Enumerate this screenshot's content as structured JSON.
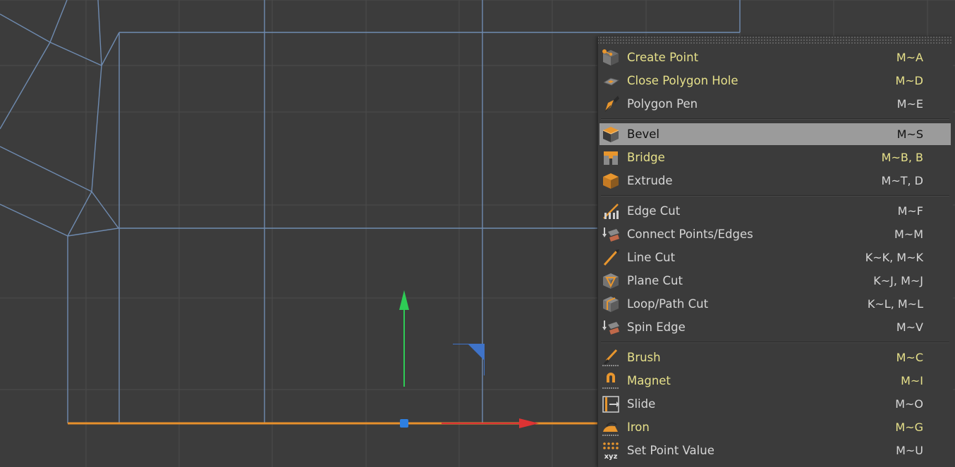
{
  "colors": {
    "viewport_bg": "#3c3c3c",
    "grid_line": "#4a4a4a",
    "wire_line": "#6f8bb0",
    "selected_edge": "#e8902c",
    "axis_y": "#2ecc55",
    "axis_x": "#dd3333",
    "menu_bg": "#3b3b3b",
    "menu_highlight_text": "#e6e08a",
    "menu_text": "#d6d6d6",
    "menu_active_bg": "#9b9b9b"
  },
  "menu": {
    "groups": [
      [
        {
          "label": "Create Point",
          "shortcut": "M~A",
          "icon": "create-point-icon",
          "highlight": true,
          "active": false
        },
        {
          "label": "Close Polygon Hole",
          "shortcut": "M~D",
          "icon": "close-polygon-hole-icon",
          "highlight": true,
          "active": false
        },
        {
          "label": "Polygon Pen",
          "shortcut": "M~E",
          "icon": "polygon-pen-icon",
          "highlight": false,
          "active": false
        }
      ],
      [
        {
          "label": "Bevel",
          "shortcut": "M~S",
          "icon": "bevel-icon",
          "highlight": false,
          "active": true
        },
        {
          "label": "Bridge",
          "shortcut": "M~B, B",
          "icon": "bridge-icon",
          "highlight": true,
          "active": false
        },
        {
          "label": "Extrude",
          "shortcut": "M~T, D",
          "icon": "extrude-icon",
          "highlight": false,
          "active": false
        }
      ],
      [
        {
          "label": "Edge Cut",
          "shortcut": "M~F",
          "icon": "edge-cut-icon",
          "highlight": false,
          "active": false
        },
        {
          "label": "Connect Points/Edges",
          "shortcut": "M~M",
          "icon": "connect-points-edges-icon",
          "highlight": false,
          "active": false
        },
        {
          "label": "Line Cut",
          "shortcut": "K~K, M~K",
          "icon": "line-cut-icon",
          "highlight": false,
          "active": false
        },
        {
          "label": "Plane Cut",
          "shortcut": "K~J, M~J",
          "icon": "plane-cut-icon",
          "highlight": false,
          "active": false
        },
        {
          "label": "Loop/Path Cut",
          "shortcut": "K~L, M~L",
          "icon": "loop-path-cut-icon",
          "highlight": false,
          "active": false
        },
        {
          "label": "Spin Edge",
          "shortcut": "M~V",
          "icon": "spin-edge-icon",
          "highlight": false,
          "active": false
        }
      ],
      [
        {
          "label": "Brush",
          "shortcut": "M~C",
          "icon": "brush-icon",
          "highlight": true,
          "active": false
        },
        {
          "label": "Magnet",
          "shortcut": "M~I",
          "icon": "magnet-icon",
          "highlight": true,
          "active": false
        },
        {
          "label": "Slide",
          "shortcut": "M~O",
          "icon": "slide-icon",
          "highlight": false,
          "active": false
        },
        {
          "label": "Iron",
          "shortcut": "M~G",
          "icon": "iron-icon",
          "highlight": true,
          "active": false
        },
        {
          "label": "Set Point Value",
          "shortcut": "M~U",
          "icon": "set-point-value-icon",
          "highlight": false,
          "active": false
        }
      ]
    ]
  },
  "icon_text": {
    "xyz": "xyz"
  }
}
